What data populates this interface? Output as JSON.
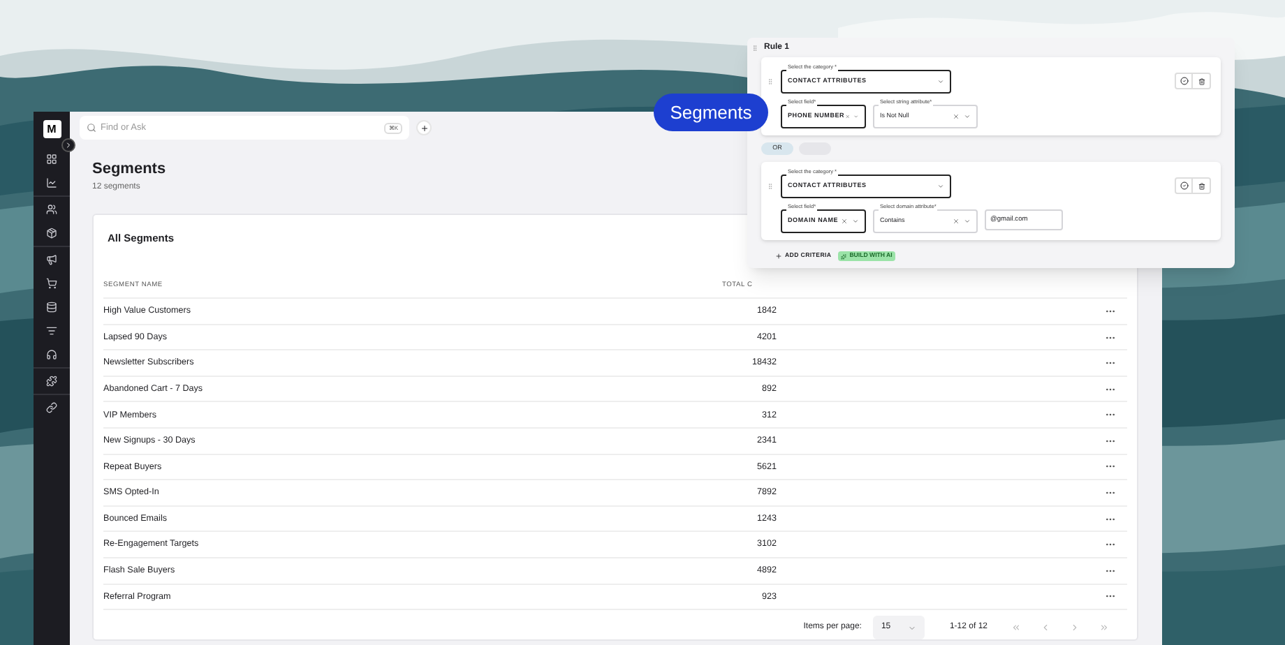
{
  "brand": {
    "letter": "M"
  },
  "search": {
    "placeholder": "Find or Ask",
    "shortcut": "⌘K"
  },
  "page": {
    "title": "Segments",
    "subtitle": "12 segments"
  },
  "card": {
    "title": "All Segments",
    "columns": [
      "SEGMENT NAME",
      "TOTAL C"
    ],
    "rows": [
      {
        "name": "High Value Customers",
        "total": "1842"
      },
      {
        "name": "Lapsed 90 Days",
        "total": "4201"
      },
      {
        "name": "Newsletter Subscribers",
        "total": "18432"
      },
      {
        "name": "Abandoned Cart - 7 Days",
        "total": "892"
      },
      {
        "name": "VIP Members",
        "total": "312"
      },
      {
        "name": "New Signups - 30 Days",
        "total": "2341"
      },
      {
        "name": "Repeat Buyers",
        "total": "5621"
      },
      {
        "name": "SMS Opted-In",
        "total": "7892"
      },
      {
        "name": "Bounced Emails",
        "total": "1243"
      },
      {
        "name": "Re-Engagement Targets",
        "total": "3102"
      },
      {
        "name": "Flash Sale Buyers",
        "total": "4892"
      },
      {
        "name": "Referral Program",
        "total": "923"
      }
    ]
  },
  "pagination": {
    "label": "Items per page:",
    "per_page": "15",
    "range": "1-12 of 12"
  },
  "badge": "Segments",
  "rule": {
    "title": "Rule 1",
    "criteria": [
      {
        "category_label": "Select the category *",
        "category": "CONTACT ATTRIBUTES",
        "field_label": "Select field*",
        "field": "PHONE NUMBER",
        "attr_label": "Select string attribute*",
        "attr": "Is Not Null"
      },
      {
        "category_label": "Select the category *",
        "category": "CONTACT ATTRIBUTES",
        "field_label": "Select field*",
        "field": "DOMAIN NAME",
        "attr_label": "Select domain attribute*",
        "attr": "Contains",
        "value": "@gmail.com"
      }
    ],
    "connectors": [
      {
        "label": "OR",
        "selected": true
      },
      {
        "selected": false
      }
    ],
    "add_label": "ADD CRITERIA",
    "ai_label": "BUILD WITH AI"
  }
}
